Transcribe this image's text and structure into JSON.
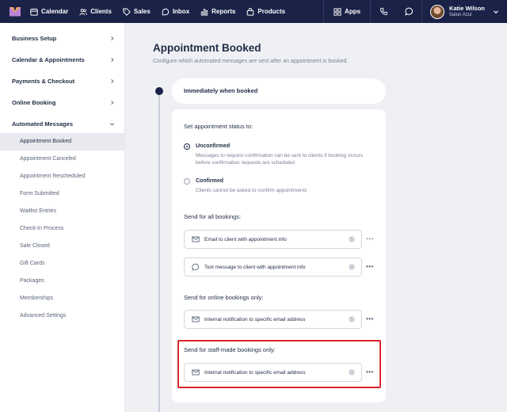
{
  "nav": {
    "items": [
      {
        "label": "Calendar",
        "icon": "calendar-icon"
      },
      {
        "label": "Clients",
        "icon": "clients-icon"
      },
      {
        "label": "Sales",
        "icon": "tag-icon"
      },
      {
        "label": "Inbox",
        "icon": "inbox-icon"
      },
      {
        "label": "Reports",
        "icon": "bar-chart-icon"
      },
      {
        "label": "Products",
        "icon": "bag-icon"
      }
    ],
    "apps_label": "Apps",
    "user_name": "Katie Wilson",
    "user_business": "Salon Azul"
  },
  "sidebar": {
    "sections": [
      {
        "label": "Business Setup"
      },
      {
        "label": "Calendar & Appointments"
      },
      {
        "label": "Payments & Checkout"
      },
      {
        "label": "Online Booking"
      },
      {
        "label": "Automated Messages"
      }
    ],
    "sub_items": [
      {
        "label": "Appointment Booked",
        "active": true
      },
      {
        "label": "Appointment Canceled"
      },
      {
        "label": "Appointment Rescheduled"
      },
      {
        "label": "Form Submitted"
      },
      {
        "label": "Waitlist Entries"
      },
      {
        "label": "Check-In Process"
      },
      {
        "label": "Sale Closed"
      },
      {
        "label": "Gift Cards"
      },
      {
        "label": "Packages"
      },
      {
        "label": "Memberships"
      },
      {
        "label": "Advanced Settings"
      }
    ]
  },
  "main": {
    "title": "Appointment Booked",
    "subtitle": "Configure which automated messages are sent after an appointment is booked.",
    "trigger_label": "Immediately when booked",
    "status_heading": "Set appointment status to:",
    "status_options": [
      {
        "label": "Unconfirmed",
        "desc": "Messages to request confirmation can be sent to clients if booking occurs before confirmation requests are scheduled",
        "selected": true
      },
      {
        "label": "Confirmed",
        "desc": "Clients cannot be asked to confirm appointments",
        "selected": false
      }
    ],
    "all_bookings_heading": "Send for all bookings:",
    "all_bookings": [
      {
        "label": "Email to client with appointment info",
        "icon": "mail-icon"
      },
      {
        "label": "Text message to client with appointment info",
        "icon": "chat-icon"
      }
    ],
    "online_heading": "Send for online bookings only:",
    "online_bookings": [
      {
        "label": "Internal notification to specific email address",
        "icon": "mail-icon"
      }
    ],
    "staff_heading": "Send for staff-made bookings only:",
    "staff_bookings": [
      {
        "label": "Internal notification to specific email address",
        "icon": "mail-icon"
      }
    ],
    "more_label": "•••"
  },
  "colors": {
    "nav_bg": "#1a2248",
    "highlight": "#d9262b",
    "page_bg": "#eef0f4"
  }
}
